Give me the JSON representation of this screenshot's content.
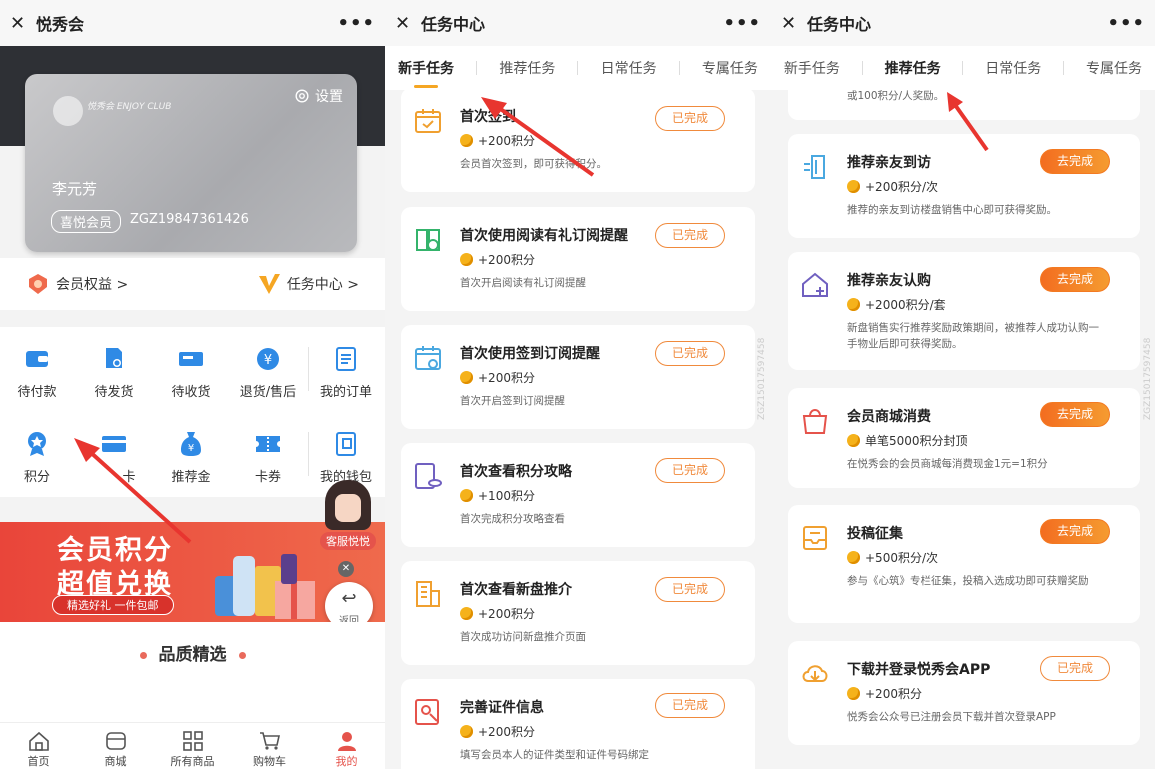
{
  "panel1": {
    "title": "悦秀会",
    "close_icon": "close-icon",
    "more": "•••",
    "card": {
      "settings_label": "设置",
      "logo_text": "悦秀会 ENJOY CLUB",
      "name": "李元芳",
      "level": "喜悦会员",
      "member_no": "ZGZ19847361426"
    },
    "links": {
      "benefits": "会员权益 >",
      "tasks": "任务中心 >"
    },
    "orders": [
      {
        "label": "待付款",
        "icon": "wallet-icon"
      },
      {
        "label": "待发货",
        "icon": "package-icon"
      },
      {
        "label": "待收货",
        "icon": "truck-icon"
      },
      {
        "label": "退货/售后",
        "icon": "refund-icon"
      },
      {
        "label": "我的订单",
        "icon": "order-list-icon"
      },
      {
        "label": "积分",
        "icon": "medal-icon"
      },
      {
        "label": "卡",
        "icon": "card-icon"
      },
      {
        "label": "推荐金",
        "icon": "money-bag-icon"
      },
      {
        "label": "卡券",
        "icon": "coupon-icon"
      },
      {
        "label": "我的钱包",
        "icon": "wallet2-icon"
      }
    ],
    "banner": {
      "line1": "会员积分",
      "line2": "超值兑换",
      "line3": "精选好礼 一件包邮"
    },
    "service_label": "客服悦悦",
    "back_label": "返回",
    "section_title": "品质精选",
    "tabbar": [
      {
        "label": "首页",
        "icon": "home-icon"
      },
      {
        "label": "商城",
        "icon": "shop-icon"
      },
      {
        "label": "所有商品",
        "icon": "grid-icon"
      },
      {
        "label": "购物车",
        "icon": "cart-icon"
      },
      {
        "label": "我的",
        "icon": "user-icon"
      }
    ]
  },
  "panel2": {
    "title": "任务中心",
    "more": "•••",
    "tabs": [
      "新手任务",
      "推荐任务",
      "日常任务",
      "专属任务"
    ],
    "active_tab": 0,
    "watermark": "ZGZ15017597458",
    "tasks": [
      {
        "title": "首次签到",
        "points": "+200积分",
        "desc": "会员首次签到，即可获得积分。",
        "status": "已完成",
        "icon": "calendar-check-icon"
      },
      {
        "title": "首次使用阅读有礼订阅提醒",
        "points": "+200积分",
        "desc": "首次开启阅读有礼订阅提醒",
        "status": "已完成",
        "icon": "book-bell-icon"
      },
      {
        "title": "首次使用签到订阅提醒",
        "points": "+200积分",
        "desc": "首次开启签到订阅提醒",
        "status": "已完成",
        "icon": "calendar-bell-icon"
      },
      {
        "title": "首次查看积分攻略",
        "points": "+100积分",
        "desc": "首次完成积分攻略查看",
        "status": "已完成",
        "icon": "guide-icon"
      },
      {
        "title": "首次查看新盘推介",
        "points": "+200积分",
        "desc": "首次成功访问新盘推介页面",
        "status": "已完成",
        "icon": "building-icon"
      },
      {
        "title": "完善证件信息",
        "points": "+200积分",
        "desc": "填写会员本人的证件类型和证件号码绑定",
        "status": "已完成",
        "icon": "id-card-icon"
      }
    ]
  },
  "panel3": {
    "title": "任务中心",
    "more": "•••",
    "tabs": [
      "新手任务",
      "推荐任务",
      "日常任务",
      "专属任务"
    ],
    "active_tab": 1,
    "watermark": "ZGZ15017597458",
    "top_note": "或100积分/人奖励。",
    "tasks": [
      {
        "title": "推荐亲友到访",
        "points": "+200积分/次",
        "desc": "推荐的亲友到访楼盘销售中心即可获得奖励。",
        "status": "去完成",
        "icon": "door-icon"
      },
      {
        "title": "推荐亲友认购",
        "points": "+2000积分/套",
        "desc": "新盘销售实行推荐奖励政策期间，被推荐人成功认购一手物业后即可获得奖励。",
        "status": "去完成",
        "icon": "house-plus-icon"
      },
      {
        "title": "会员商城消费",
        "points": "单笔5000积分封顶",
        "desc": "在悦秀会的会员商城每消费现金1元=1积分",
        "status": "去完成",
        "icon": "shopping-bag-icon"
      },
      {
        "title": "投稿征集",
        "points": "+500积分/次",
        "desc": "参与《心筑》专栏征集，投稿入选成功即可获赠奖励",
        "status": "去完成",
        "icon": "inbox-icon"
      },
      {
        "title": "下载并登录悦秀会APP",
        "points": "+200积分",
        "desc": "悦秀会公众号已注册会员下载并首次登录APP",
        "status": "已完成",
        "icon": "cloud-download-icon"
      }
    ]
  },
  "colors": {
    "accent": "#f08a3c",
    "arrow": "#e8352f",
    "brand_red": "#e5534b",
    "orange_btn": "#f37a22"
  }
}
